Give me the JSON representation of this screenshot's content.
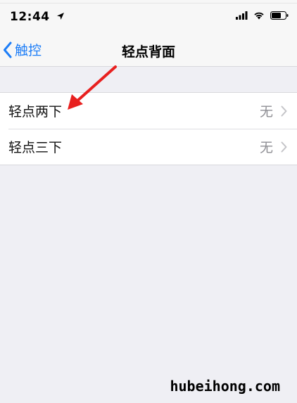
{
  "status_bar": {
    "time": "12:44",
    "location_icon": "location-arrow-icon",
    "signal_icon": "cellular-signal-icon",
    "wifi_icon": "wifi-icon",
    "battery_icon": "battery-icon"
  },
  "nav": {
    "back_label": "触控",
    "title": "轻点背面"
  },
  "settings": {
    "rows": [
      {
        "label": "轻点两下",
        "value": "无"
      },
      {
        "label": "轻点三下",
        "value": "无"
      }
    ]
  },
  "annotation": {
    "arrow_color": "#e8201f"
  },
  "watermark": "hubeihong.com",
  "colors": {
    "accent": "#1e7ef7",
    "background": "#efeff4",
    "secondary_text": "#8e8e93"
  }
}
